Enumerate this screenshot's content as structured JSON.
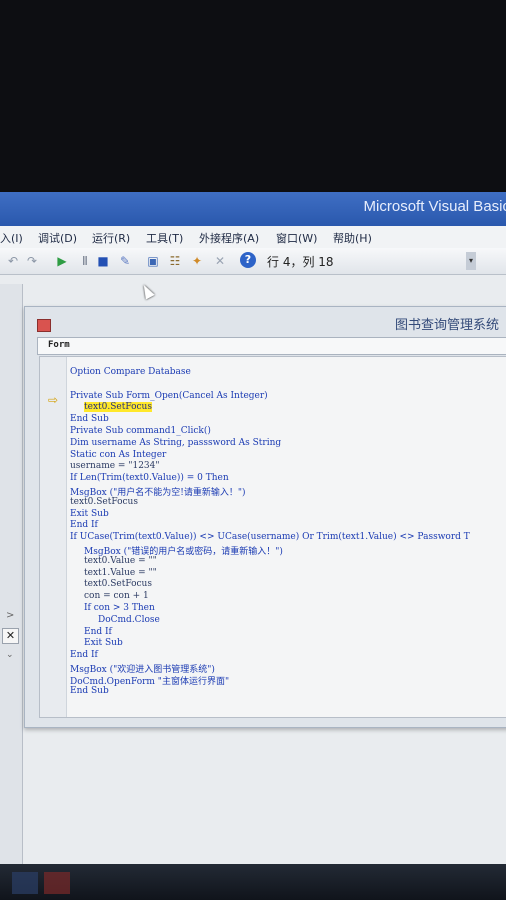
{
  "app": {
    "title": "Microsoft Visual Basic"
  },
  "menu": [
    {
      "label": "入(I)"
    },
    {
      "label": "调试(D)"
    },
    {
      "label": "运行(R)"
    },
    {
      "label": "工具(T)"
    },
    {
      "label": "外接程序(A)"
    },
    {
      "label": "窗口(W)"
    },
    {
      "label": "帮助(H)"
    }
  ],
  "toolbar": {
    "icons": [
      "undo-icon",
      "redo-icon",
      "run-icon",
      "pause-icon",
      "stop-icon",
      "design-mode-icon",
      "project-explorer-icon",
      "properties-icon",
      "object-browser-icon",
      "toolbox-icon",
      "help-icon"
    ],
    "help_label": "?",
    "status": "行 4，列 18"
  },
  "code_window": {
    "title": "图书查询管理系统",
    "object_combo": "Form",
    "lines": [
      {
        "text": "Option Compare Database",
        "indent": 0
      },
      {
        "text": "",
        "indent": 0
      },
      {
        "text": "Private Sub Form_Open(Cancel As Integer)",
        "indent": 0
      },
      {
        "text": "text0.SetFocus",
        "indent": 1,
        "highlight": true
      },
      {
        "text": "End Sub",
        "indent": 0
      },
      {
        "text": "Private Sub command1_Click()",
        "indent": 0
      },
      {
        "text": "Dim username As String, passsword As String",
        "indent": 0
      },
      {
        "text": "Static con As Integer",
        "indent": 0
      },
      {
        "text": "username = \"1234\"",
        "indent": 0
      },
      {
        "text": "If Len(Trim(text0.Value)) = 0 Then",
        "indent": 0
      },
      {
        "text": "MsgBox (\"用户名不能为空!请重新输入！\")",
        "indent": 0
      },
      {
        "text": "text0.SetFocus",
        "indent": 0
      },
      {
        "text": "Exit Sub",
        "indent": 0
      },
      {
        "text": "End If",
        "indent": 0
      },
      {
        "text": "If UCase(Trim(text0.Value)) <> UCase(username) Or Trim(text1.Value) <> Password T",
        "indent": 0
      },
      {
        "text": "MsgBox (\"错误的用户名或密码，请重新输入！\")",
        "indent": 1
      },
      {
        "text": "text0.Value = \"\"",
        "indent": 1
      },
      {
        "text": "text1.Value = \"\"",
        "indent": 1
      },
      {
        "text": "text0.SetFocus",
        "indent": 1
      },
      {
        "text": "con = con + 1",
        "indent": 1
      },
      {
        "text": "If con > 3 Then",
        "indent": 1
      },
      {
        "text": "DoCmd.Close",
        "indent": 2
      },
      {
        "text": "End If",
        "indent": 1
      },
      {
        "text": "Exit Sub",
        "indent": 1
      },
      {
        "text": "End If",
        "indent": 0
      },
      {
        "text": "MsgBox (\"欢迎进入图书管理系统\")",
        "indent": 0
      },
      {
        "text": "DoCmd.OpenForm \"主窗体运行界面\"",
        "indent": 0
      },
      {
        "text": "End Sub",
        "indent": 0
      }
    ]
  },
  "left_panel": {
    "arrow_label": ">",
    "close_label": "✕",
    "chevron_label": "⌄"
  }
}
